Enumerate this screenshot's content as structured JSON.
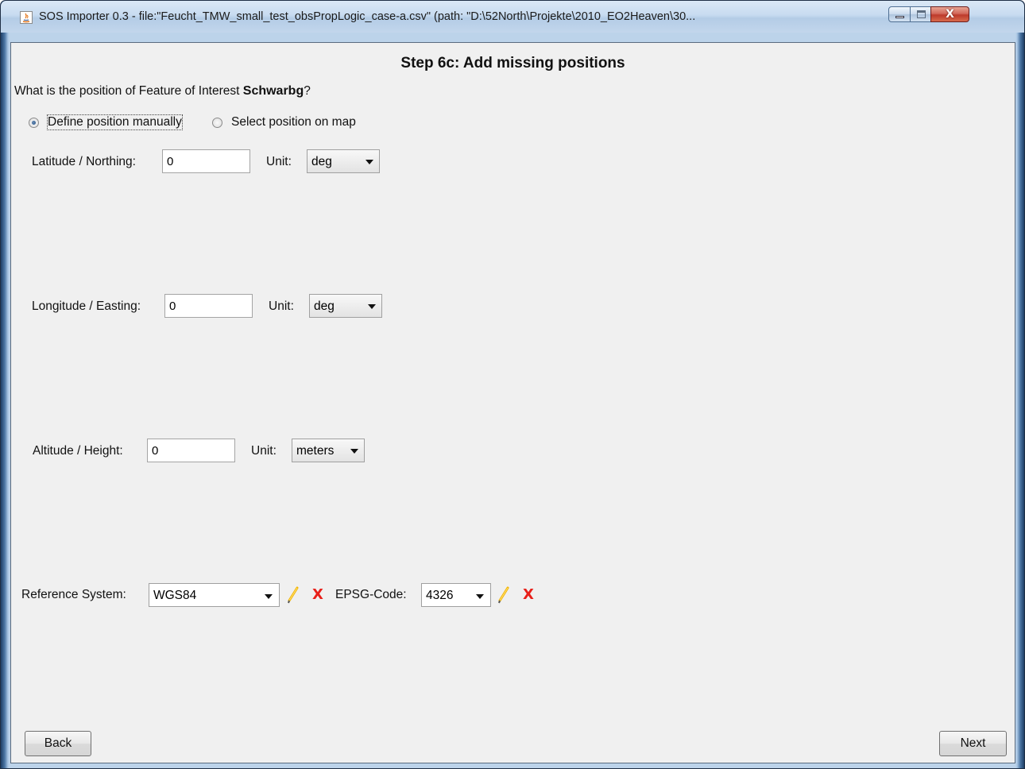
{
  "window": {
    "title": "SOS Importer 0.3 - file:\"Feucht_TMW_small_test_obsPropLogic_case-a.csv\" (path: \"D:\\52North\\Projekte\\2010_EO2Heaven\\30...",
    "close_label": "X"
  },
  "step": {
    "heading": "Step 6c: Add missing positions",
    "question_prefix": "What is the position of Feature of Interest ",
    "feature_name": "Schwarbg",
    "question_suffix": "?"
  },
  "mode": {
    "manual_label": "Define position manually",
    "map_label": "Select position on map",
    "selected": "manual"
  },
  "latitude": {
    "label": "Latitude / Northing:",
    "value": "0",
    "unit_label": "Unit:",
    "unit": "deg"
  },
  "longitude": {
    "label": "Longitude / Easting:",
    "value": "0",
    "unit_label": "Unit:",
    "unit": "deg"
  },
  "altitude": {
    "label": "Altitude / Height:",
    "value": "0",
    "unit_label": "Unit:",
    "unit": "meters"
  },
  "reference": {
    "label": "Reference System:",
    "value": "WGS84",
    "epsg_label": "EPSG-Code:",
    "epsg_value": "4326",
    "edit_icon": "pencil-icon",
    "delete_icon": "red-x-icon",
    "delete_glyph": "X",
    "delete_color": "#e8201a"
  },
  "nav": {
    "back_label": "Back",
    "next_label": "Next"
  }
}
